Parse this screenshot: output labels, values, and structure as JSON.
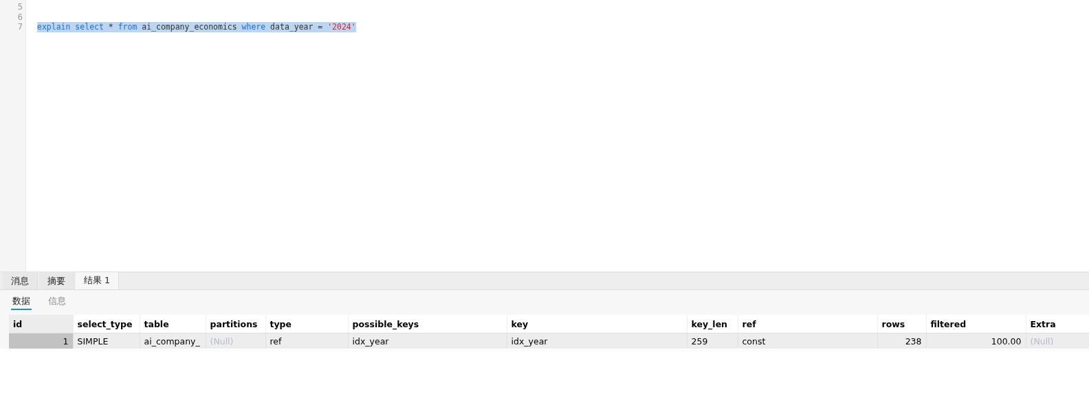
{
  "editor": {
    "lines": [
      {
        "number": "5",
        "selected": false
      },
      {
        "number": "6",
        "selected": false
      },
      {
        "number": "7",
        "selected": true,
        "tokens": [
          {
            "kind": "keyword",
            "text": "explain"
          },
          {
            "kind": "keyword",
            "text": "select"
          },
          {
            "kind": "plain",
            "text": "*"
          },
          {
            "kind": "keyword",
            "text": "from"
          },
          {
            "kind": "plain",
            "text": "ai_company_economics"
          },
          {
            "kind": "keyword",
            "text": "where"
          },
          {
            "kind": "plain",
            "text": "data_year"
          },
          {
            "kind": "plain",
            "text": "="
          },
          {
            "kind": "string",
            "text": "'2024'"
          }
        ]
      }
    ]
  },
  "result_tabs": [
    {
      "label": "消息",
      "selected": false
    },
    {
      "label": "摘要",
      "selected": false
    },
    {
      "label": "结果 1",
      "selected": true
    }
  ],
  "view_tabs": [
    {
      "label": "数据",
      "selected": true
    },
    {
      "label": "信息",
      "selected": false
    }
  ],
  "table": {
    "columns": [
      {
        "label": "id",
        "kind": "number"
      },
      {
        "label": "select_type",
        "kind": "text"
      },
      {
        "label": "table",
        "kind": "text"
      },
      {
        "label": "partitions",
        "kind": "text"
      },
      {
        "label": "type",
        "kind": "text"
      },
      {
        "label": "possible_keys",
        "kind": "text"
      },
      {
        "label": "key",
        "kind": "text"
      },
      {
        "label": "key_len",
        "kind": "text"
      },
      {
        "label": "ref",
        "kind": "text"
      },
      {
        "label": "rows",
        "kind": "number"
      },
      {
        "label": "filtered",
        "kind": "number"
      },
      {
        "label": "Extra",
        "kind": "text"
      }
    ],
    "rows": [
      {
        "selected": true,
        "cells": [
          {
            "text": "1",
            "null": false
          },
          {
            "text": "SIMPLE",
            "null": false
          },
          {
            "text": "ai_company_",
            "null": false
          },
          {
            "text": "(Null)",
            "null": true
          },
          {
            "text": "ref",
            "null": false
          },
          {
            "text": "idx_year",
            "null": false
          },
          {
            "text": "idx_year",
            "null": false
          },
          {
            "text": "259",
            "null": false
          },
          {
            "text": "const",
            "null": false
          },
          {
            "text": "238",
            "null": false
          },
          {
            "text": "100.00",
            "null": false
          },
          {
            "text": "(Null)",
            "null": true
          }
        ]
      }
    ]
  }
}
